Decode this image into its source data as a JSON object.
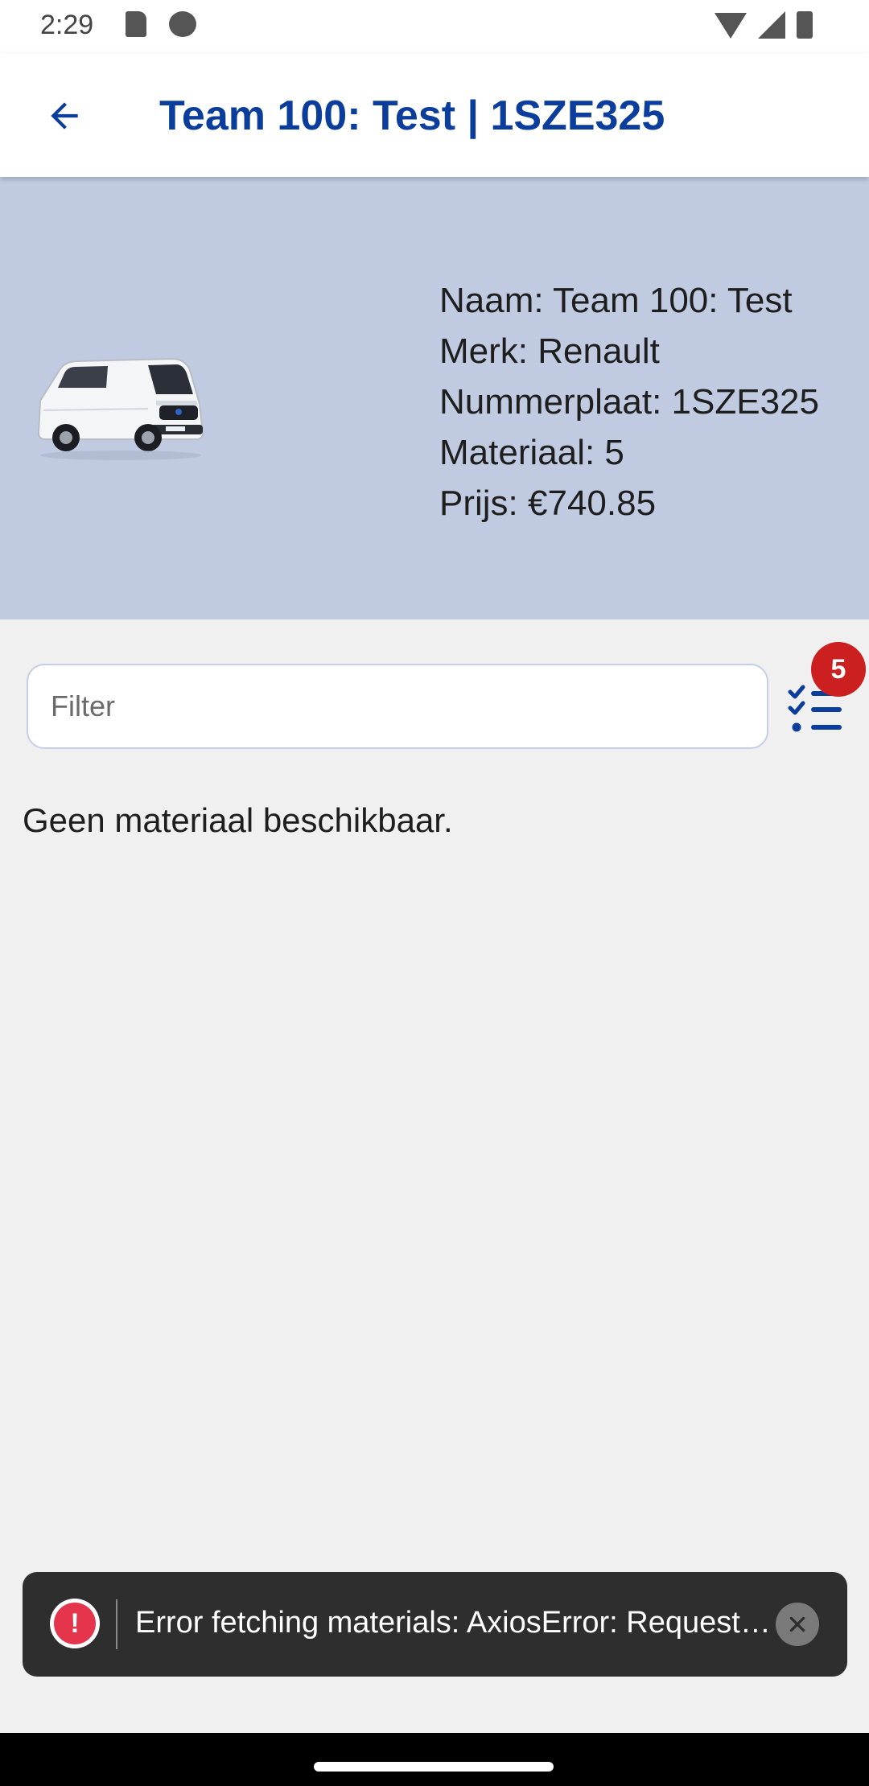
{
  "status_bar": {
    "time": "2:29"
  },
  "header": {
    "title": "Team 100: Test | 1SZE325"
  },
  "vehicle": {
    "naam": "Naam: Team 100: Test",
    "merk": "Merk: Renault",
    "nummerplaat": "Nummerplaat: 1SZE325",
    "materiaal": "Materiaal: 5",
    "prijs": "Prijs: €740.85"
  },
  "filter": {
    "placeholder": "Filter",
    "value": "",
    "badge_count": "5"
  },
  "main": {
    "empty_message": "Geen materiaal beschikbaar."
  },
  "toast": {
    "message": "Error fetching materials: AxiosError: Request failed"
  },
  "colors": {
    "primary": "#0b3e9c",
    "card_background": "#c0cbe2",
    "badge": "#cc1f1f",
    "toast_background": "#2e2e2e",
    "error": "#e5354d"
  },
  "icons": {
    "back": "arrow-left-icon",
    "checklist": "checklist-icon",
    "error": "exclamation-circle-icon",
    "close": "close-icon"
  }
}
